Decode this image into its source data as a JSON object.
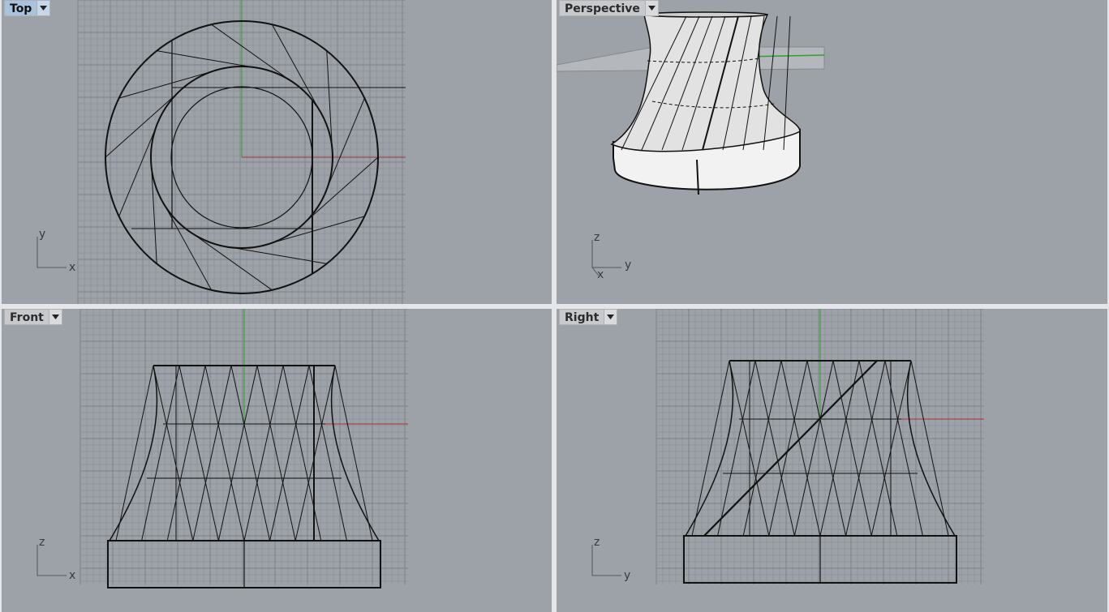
{
  "viewports": {
    "top": {
      "title": "Top",
      "axis_h": "x",
      "axis_v": "y"
    },
    "perspective": {
      "title": "Perspective",
      "axis_h": "y",
      "axis_v": "z",
      "axis_diag": "x"
    },
    "front": {
      "title": "Front",
      "axis_h": "x",
      "axis_v": "z"
    },
    "right": {
      "title": "Right",
      "axis_h": "y",
      "axis_v": "z"
    }
  },
  "colors": {
    "viewport_bg": "#9da2a9",
    "grid_minor": "#8f949b",
    "grid_major": "#7d8289",
    "x_axis": "#a83232",
    "y_axis": "#2fa02f",
    "wire": "#111111",
    "active_tab": "#a9c2de"
  },
  "icons": {
    "viewport_menu": "triangle-down-icon"
  }
}
